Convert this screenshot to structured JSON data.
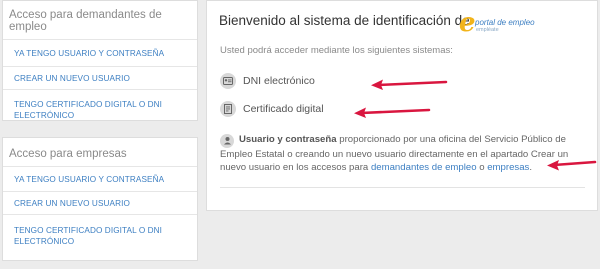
{
  "left_panels": [
    {
      "title": "Acceso para demandantes de empleo",
      "links": [
        "YA TENGO USUARIO Y CONTRASEÑA",
        "CREAR UN NUEVO USUARIO",
        "TENGO CERTIFICADO DIGITAL O DNI ELECTRÓNICO"
      ]
    },
    {
      "title": "Acceso para empresas",
      "links": [
        "YA TENGO USUARIO Y CONTRASEÑA",
        "CREAR UN NUEVO USUARIO",
        "TENGO CERTIFICADO DIGITAL O DNI ELECTRÓNICO"
      ]
    }
  ],
  "main": {
    "welcome": "Bienvenido al sistema de identificación de",
    "logo": {
      "letter": "e",
      "line1": "portal de empleo",
      "line2": "empléate"
    },
    "intro": "Usted podrá acceder mediante los siguientes sistemas:",
    "methods": [
      {
        "label": "DNI electrónico",
        "icon": "id-card-icon"
      },
      {
        "label": "Certificado digital",
        "icon": "certificate-icon"
      }
    ],
    "user_pass": {
      "bold": "Usuario y contraseña",
      "text1": " proporcionado por una oficina del Servicio Público de Empleo Estatal o creando un nuevo usuario directamente en el apartado Crear un nuevo usuario en los accesos para ",
      "link1": "demandantes de empleo",
      "text2": " o ",
      "link2": "empresas",
      "text3": "."
    }
  },
  "colors": {
    "link": "#3d7fc2",
    "arrow": "#d9163f",
    "logo_yellow": "#f2b41a"
  }
}
